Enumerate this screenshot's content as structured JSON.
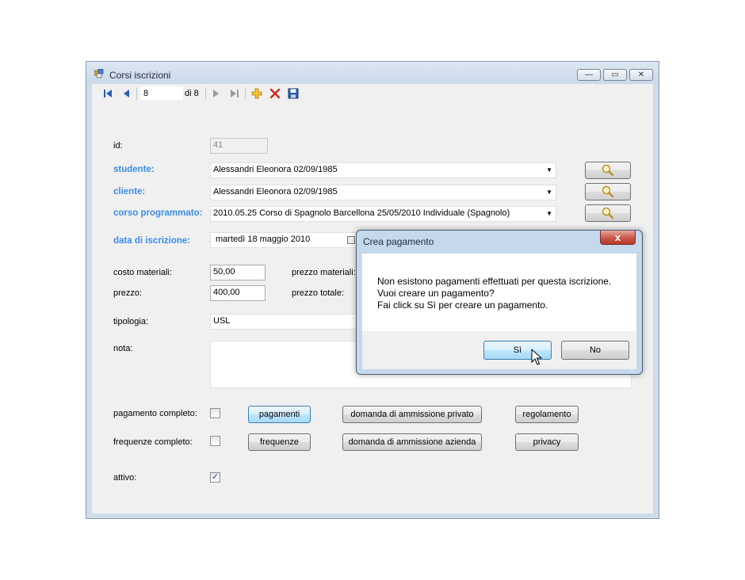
{
  "window": {
    "title": "Corsi iscrizioni",
    "minimize": "—",
    "maximize": "▭",
    "close": "✕"
  },
  "toolbar": {
    "position_value": "8",
    "of_text": "di 8",
    "icons": [
      "first-icon",
      "prev-icon",
      "next-icon",
      "last-icon",
      "add-icon",
      "delete-icon",
      "save-icon"
    ]
  },
  "form": {
    "id_label": "id:",
    "id_value": "41",
    "studente_label": "studente:",
    "studente_value": "Alessandri Eleonora 02/09/1985",
    "cliente_label": "cliente:",
    "cliente_value": "Alessandri Eleonora 02/09/1985",
    "corso_label": "corso programmato:",
    "corso_value": "2010.05.25 Corso di Spagnolo Barcellona 25/05/2010 Individuale (Spagnolo)",
    "data_label": "data di iscrizione:",
    "data_value": "martedì   18   maggio   2010",
    "costo_label": "costo materiali:",
    "costo_value": "50,00",
    "prezzo_materiali_label": "prezzo materiali:",
    "prezzo_label": "prezzo:",
    "prezzo_value": "400,00",
    "prezzo_totale_label": "prezzo totale:",
    "tipologia_label": "tipologia:",
    "tipologia_value": "USL",
    "nota_label": "nota:",
    "pagamento_completo_label": "pagamento completo:",
    "frequenze_completo_label": "frequenze completo:",
    "attivo_label": "attivo:",
    "attivo_checked": "✓"
  },
  "buttons": {
    "pagamenti": "pagamenti",
    "frequenze": "frequenze",
    "domanda_privato": "domanda di ammissione privato",
    "domanda_azienda": "domanda di ammissione azienda",
    "regolamento": "regolamento",
    "privacy": "privacy"
  },
  "dialog": {
    "title": "Crea pagamento",
    "close": "x",
    "message": "Non esistono pagamenti effettuati per questa iscrizione.\nVuoi creare un pagamento?\nFai click su Sì per creare un pagamento.",
    "yes": "Sì",
    "no": "No"
  },
  "colors": {
    "label_blue": "#3a8ee6",
    "window_frame": "#cfdcec",
    "client_bg": "#f0f0f0"
  }
}
